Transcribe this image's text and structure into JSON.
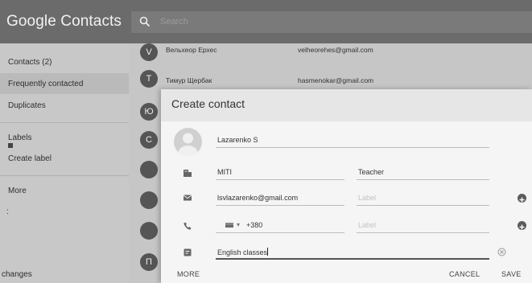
{
  "app": {
    "title": "Google Contacts"
  },
  "search": {
    "placeholder": "Search"
  },
  "sidebar": {
    "items": [
      {
        "label": "Contacts (2)"
      },
      {
        "label": "Frequently contacted"
      },
      {
        "label": "Duplicates"
      },
      {
        "label": "Labels"
      },
      {
        "label": "Create label"
      },
      {
        "label": "More"
      },
      {
        "label": ":"
      },
      {
        "label": "changes"
      }
    ]
  },
  "contacts": [
    {
      "initial": "V",
      "name": "Вельхеор Ерхес",
      "email": "velheorehes@gmail.com"
    },
    {
      "initial": "Т",
      "name": "Тимур Щербак",
      "email": "hasmenokar@gmail.com"
    },
    {
      "initial": "Ю"
    },
    {
      "initial": "С"
    },
    {
      "initial": ""
    },
    {
      "initial": ""
    },
    {
      "initial": ""
    },
    {
      "initial": "П"
    }
  ],
  "dialog": {
    "title": "Create contact",
    "name_value": "Lazarenko S",
    "company_value": "MITI",
    "job_title_value": "Teacher",
    "email_value": "lsvlazarenko@gmail.com",
    "email_label_placeholder": "Label",
    "phone_country_chevron": "▾",
    "phone_value": "+380",
    "phone_label_placeholder": "Label",
    "notes_value": "English classes",
    "more_label": "MORE",
    "cancel_label": "CANCEL",
    "save_label": "SAVE"
  },
  "colors": {
    "topbar": "#6b6b6b",
    "sidebar": "#c8c8c8",
    "dialog": "#f5f5f5"
  }
}
